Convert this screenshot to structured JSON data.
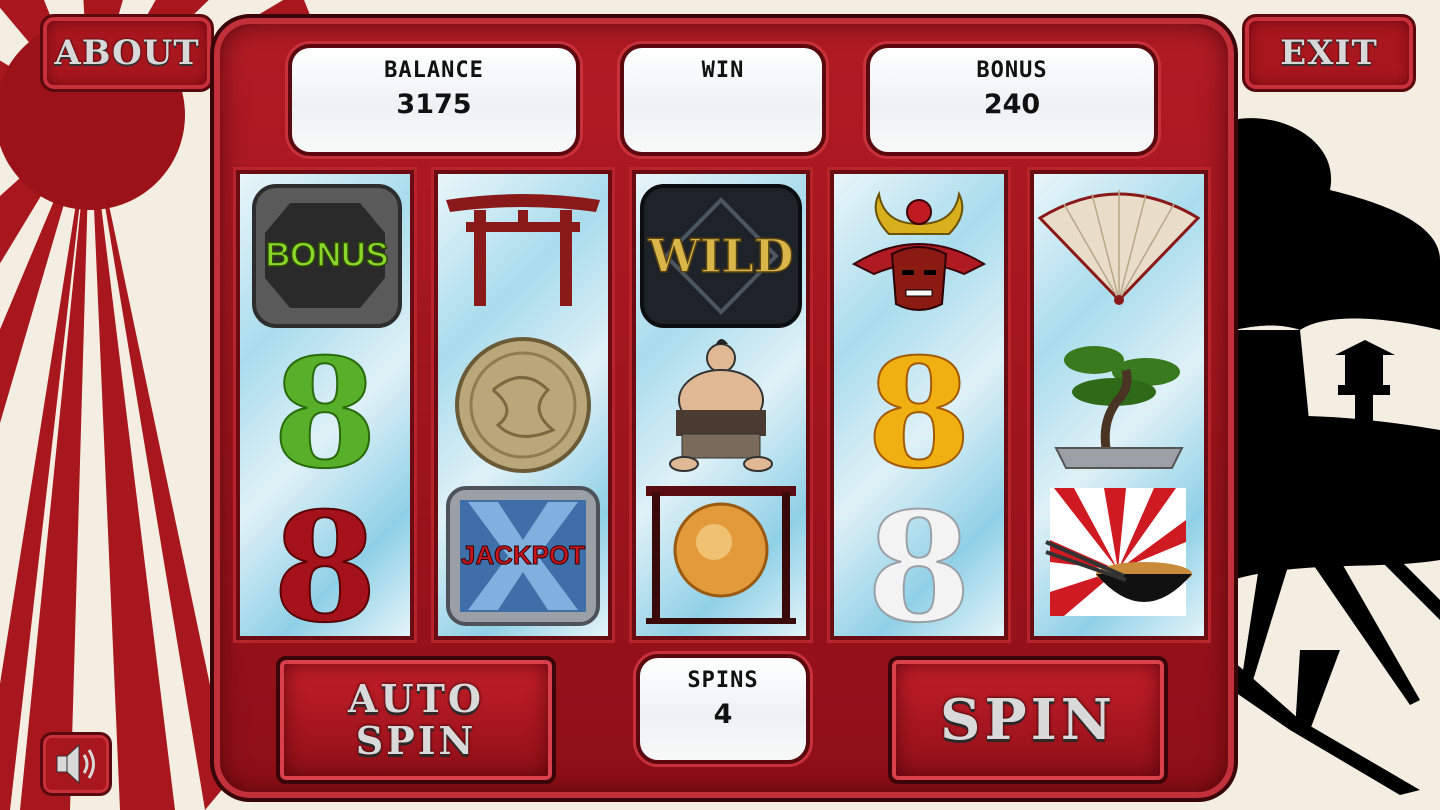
{
  "buttons": {
    "about": "ABOUT",
    "exit": "EXIT",
    "auto_spin": "AUTO SPIN",
    "spin": "SPIN"
  },
  "meters": {
    "balance": {
      "label": "BALANCE",
      "value": "3175"
    },
    "win": {
      "label": "WIN",
      "value": ""
    },
    "bonus": {
      "label": "BONUS",
      "value": "240"
    },
    "spins": {
      "label": "SPINS",
      "value": "4"
    }
  },
  "reels": [
    [
      "bonus-tile",
      "green-8",
      "red-8"
    ],
    [
      "torii-gate",
      "gold-coin",
      "jackpot-tile"
    ],
    [
      "wild-tile",
      "sumo-wrestler",
      "gong"
    ],
    [
      "samurai-helmet",
      "yellow-8",
      "white-8"
    ],
    [
      "folding-fan",
      "bonsai-tree",
      "rising-sun-noodle-bowl"
    ]
  ],
  "symbol_text": {
    "bonus": "BONUS",
    "wild": "WILD",
    "jackpot": "JACKPOT",
    "eight": "8"
  },
  "colors": {
    "cabinet_red": "#a8161e",
    "reel_blue": "#a9dcec"
  }
}
